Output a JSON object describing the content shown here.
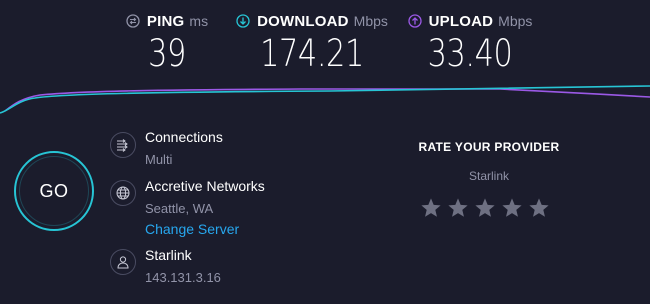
{
  "metrics": {
    "ping": {
      "label": "PING",
      "unit": "ms",
      "value": "39",
      "icon": "ping-icon"
    },
    "download": {
      "label": "DOWNLOAD",
      "unit": "Mbps",
      "value": "174.21",
      "icon": "download-arrow-icon"
    },
    "upload": {
      "label": "UPLOAD",
      "unit": "Mbps",
      "value": "33.40",
      "icon": "upload-arrow-icon"
    }
  },
  "go_button": {
    "label": "GO"
  },
  "connections": {
    "title": "Connections",
    "value": "Multi",
    "icon": "connections-icon"
  },
  "server": {
    "name": "Accretive Networks",
    "location": "Seattle, WA",
    "change_link": "Change Server",
    "icon": "globe-icon"
  },
  "provider": {
    "name": "Starlink",
    "ip": "143.131.3.16",
    "icon": "person-icon"
  },
  "rating": {
    "title": "RATE YOUR PROVIDER",
    "provider": "Starlink",
    "stars_total": 5,
    "stars_selected": 0
  },
  "colors": {
    "background": "#1b1c2c",
    "download_accent": "#27c5d5",
    "upload_accent": "#9b59e6",
    "link": "#27a7ee",
    "muted_text": "#9193a8",
    "star": "#6e7082"
  }
}
